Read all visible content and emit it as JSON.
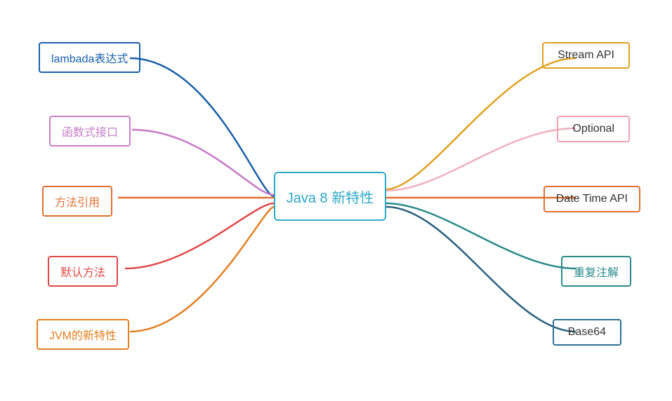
{
  "title": "Java 8 新特性",
  "center": {
    "label": "Java 8 新特性"
  },
  "left_nodes": [
    {
      "id": "lambada",
      "label": "lambada表达式",
      "color": "#1a5fa8"
    },
    {
      "id": "hanshu",
      "label": "函数式接口",
      "color": "#c87ec8"
    },
    {
      "id": "fangfa",
      "label": "方法引用",
      "color": "#e07030"
    },
    {
      "id": "moren",
      "label": "默认方法",
      "color": "#e04848"
    },
    {
      "id": "jvm",
      "label": "JVM的新特性",
      "color": "#e08020"
    }
  ],
  "right_nodes": [
    {
      "id": "stream",
      "label": "Stream API",
      "color": "#e0a020"
    },
    {
      "id": "optional",
      "label": "Optional",
      "color": "#f0a0b0"
    },
    {
      "id": "datetime",
      "label": "Date Time API",
      "color": "#e07030"
    },
    {
      "id": "chongfu",
      "label": "重复注解",
      "color": "#2a8a8a"
    },
    {
      "id": "base64",
      "label": "Base64",
      "color": "#2a7090"
    }
  ],
  "curves": [
    {
      "id": "lambada",
      "color": "#1a5fa8"
    },
    {
      "id": "hanshu",
      "color": "#c878c8"
    },
    {
      "id": "fangfa",
      "color": "#e07030"
    },
    {
      "id": "moren",
      "color": "#e04848"
    },
    {
      "id": "jvm",
      "color": "#e08020"
    },
    {
      "id": "stream",
      "color": "#e0a020"
    },
    {
      "id": "optional",
      "color": "#f0b0c0"
    },
    {
      "id": "datetime",
      "color": "#e07030"
    },
    {
      "id": "chongfu",
      "color": "#2a8a8a"
    },
    {
      "id": "base64",
      "color": "#2a6080"
    }
  ]
}
